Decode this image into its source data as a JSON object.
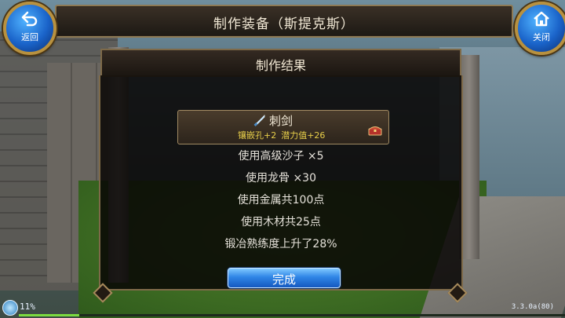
{
  "header": {
    "title": "制作装备（斯提克斯）",
    "back_label": "返回",
    "close_label": "关闭"
  },
  "dialog": {
    "title": "制作结果",
    "item": {
      "name": "刺剑",
      "stat_sockets": "镶嵌孔+2",
      "stat_potential": "潜力值+26",
      "icon": "sword-icon",
      "chest_icon": "treasure-chest-icon"
    },
    "lines": [
      "使用高级沙子 ×5",
      "使用龙骨 ×30",
      "使用金属共100点",
      "使用木材共25点",
      "锻冶熟练度上升了28%"
    ],
    "confirm_label": "完成"
  },
  "status": {
    "exp_percent_text": "11%",
    "exp_fraction": 0.11,
    "version": "3.3.0a(80)"
  },
  "colors": {
    "accent_blue": "#2f86e6",
    "stat_yellow": "#e8cf4a",
    "frame_gold": "#b8913f"
  }
}
